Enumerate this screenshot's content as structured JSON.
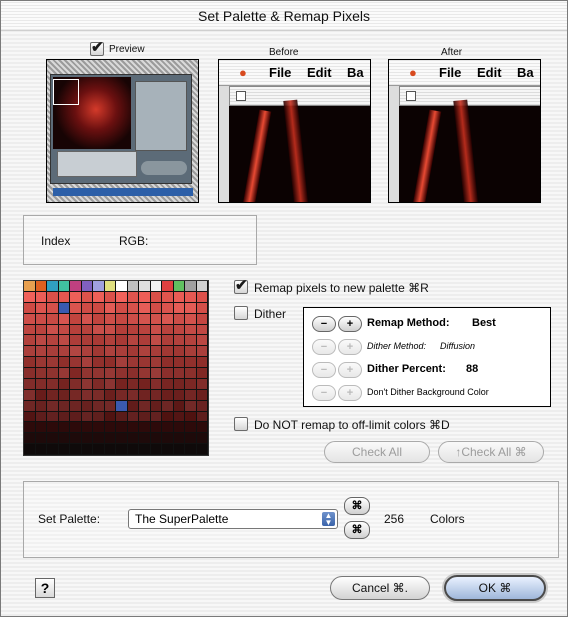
{
  "window": {
    "title": "Set Palette & Remap Pixels"
  },
  "preview": {
    "checkbox_label": "Preview",
    "checked": true
  },
  "before": {
    "label": "Before"
  },
  "after": {
    "label": "After"
  },
  "menu": {
    "apple_icon": "apple-icon",
    "items": [
      "File",
      "Edit",
      "Ba"
    ]
  },
  "info": {
    "index_label": "Index",
    "rgb_label": "RGB:"
  },
  "remap": {
    "label": "Remap pixels to new palette ⌘R",
    "checked": true
  },
  "dither": {
    "label": "Dither",
    "checked": false
  },
  "options": {
    "remap_method": {
      "label": "Remap Method:",
      "value": "Best"
    },
    "dither_method": {
      "label": "Dither Method:",
      "value": "Diffusion"
    },
    "dither_percent": {
      "label": "Dither Percent:",
      "value": "88"
    },
    "dont_dither_bg": {
      "label": "Don't Dither Background Color"
    }
  },
  "steppers": {
    "minus": "−",
    "plus": "+"
  },
  "do_not_remap": {
    "label": "Do NOT remap to off-limit colors ⌘D",
    "checked": false
  },
  "buttons": {
    "check_all": "Check All",
    "uncheck_all": "↑Check All ⌘",
    "cancel": "Cancel ⌘.",
    "ok": "OK ⌘",
    "help": "?"
  },
  "set_palette": {
    "label": "Set Palette:",
    "selected": "The SuperPalette",
    "count": "256",
    "count_label": "Colors",
    "cmd_glyph": "⌘"
  },
  "colors": {
    "accent": "#3b64aa",
    "palette_base": "#cc3333"
  }
}
